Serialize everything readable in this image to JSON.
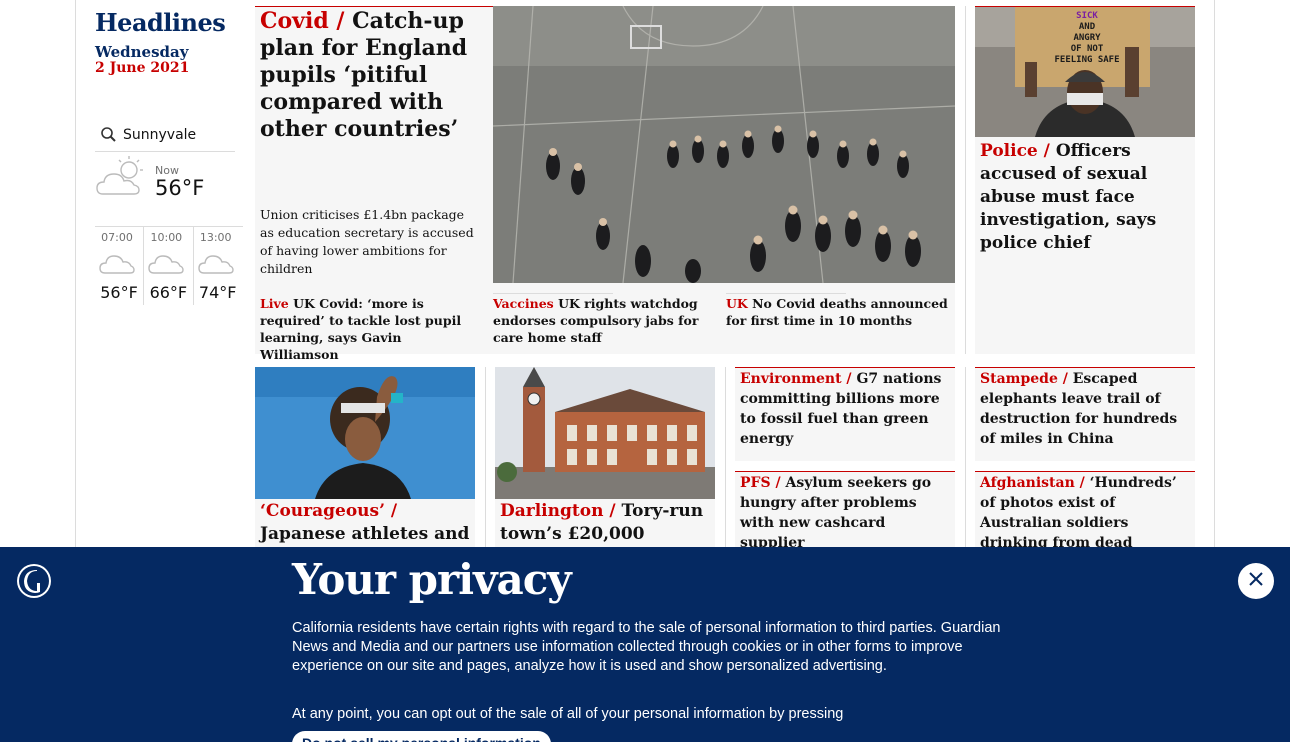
{
  "section": {
    "title": "Headlines",
    "weekday": "Wednesday",
    "date": "2 June 2021"
  },
  "weather": {
    "location": "Sunnyvale",
    "now_label": "Now",
    "now_temp": "56°F",
    "forecast": [
      {
        "time": "07:00",
        "temp": "56°F",
        "icon": "cloud-icon"
      },
      {
        "time": "10:00",
        "temp": "66°F",
        "icon": "cloud-icon"
      },
      {
        "time": "13:00",
        "temp": "74°F",
        "icon": "cloud-icon"
      }
    ]
  },
  "lead": {
    "kicker": "Covid /",
    "headline": "Catch-up plan for England pupils ‘pitiful compared with other countries’",
    "standfirst": "Union criticises £1.4bn package as education secretary is accused of having lower ambitions for children",
    "image": "schoolchildren-in-playground-image",
    "sublinks": [
      {
        "kicker": "Live",
        "text": "UK Covid: ‘more is required’ to tackle lost pupil learning, says Gavin Williamson"
      },
      {
        "kicker": "Vaccines",
        "text": "UK rights watchdog endorses compulsory jabs for care home staff"
      },
      {
        "kicker": "UK",
        "text": "No Covid deaths announced for first time in 10 months"
      }
    ]
  },
  "police": {
    "kicker": "Police /",
    "headline": "Officers accused of sexual abuse must face investigation, says police chief",
    "image": "protester-with-placard-image",
    "placard": [
      "SICK",
      "AND",
      "ANGRY",
      "OF NOT",
      "FEELING SAFE"
    ]
  },
  "osaka": {
    "kicker": "‘Courageous’ /",
    "headline": "Japanese athletes and",
    "image": "tennis-player-image"
  },
  "darlington": {
    "kicker": "Darlington /",
    "headline": "Tory-run town’s £20,000",
    "image": "town-hall-clocktower-image"
  },
  "small_stories": [
    {
      "kicker": "Environment /",
      "headline": "G7 nations committing billions more to fossil fuel than green energy"
    },
    {
      "kicker": "PFS /",
      "headline": "Asylum seekers go hungry after problems with new cashcard supplier"
    },
    {
      "kicker": "Stampede /",
      "headline": "Escaped elephants leave trail of destruction for hundreds of miles in China"
    },
    {
      "kicker": "Afghanistan /",
      "headline": "‘Hundreds’ of photos exist of Australian soldiers drinking from dead"
    }
  ],
  "privacy": {
    "title": "Your privacy",
    "body": "California residents have certain rights with regard to the sale of personal information to third parties. Guardian News and Media and our partners use information collected through cookies or in other forms to improve experience on our site and pages, analyze how it is used and show personalized advertising.",
    "body2": "At any point, you can opt out of the sale of all of your personal information by pressing",
    "optout_label": "Do not sell my personal information"
  },
  "colors": {
    "brand_blue": "#052962",
    "news_red": "#c70000",
    "card_bg": "#f6f6f6"
  }
}
